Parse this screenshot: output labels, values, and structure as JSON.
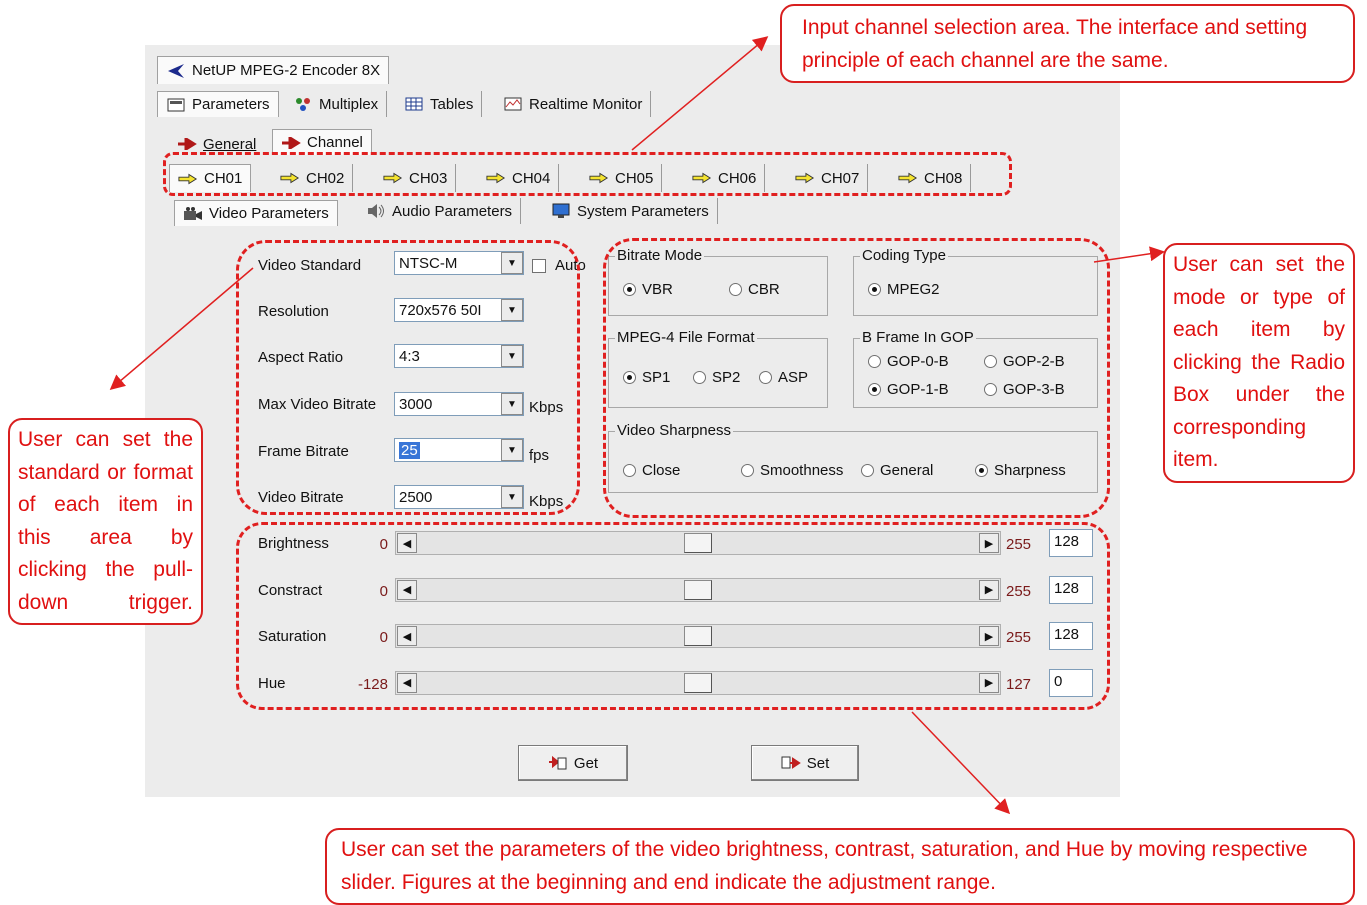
{
  "app": {
    "title": "NetUP MPEG-2 Encoder 8X"
  },
  "main_tabs": [
    {
      "label": "Parameters",
      "icon": "parameters-icon"
    },
    {
      "label": "Multiplex",
      "icon": "multiplex-icon"
    },
    {
      "label": "Tables",
      "icon": "tables-icon"
    },
    {
      "label": "Realtime Monitor",
      "icon": "realtime-monitor-icon"
    }
  ],
  "sub_tabs": [
    {
      "label": "General",
      "icon": "red-arrow-icon"
    },
    {
      "label": "Channel",
      "icon": "red-arrow-icon"
    }
  ],
  "channels": [
    "CH01",
    "CH02",
    "CH03",
    "CH04",
    "CH05",
    "CH06",
    "CH07",
    "CH08"
  ],
  "param_tabs": [
    {
      "label": "Video Parameters",
      "icon": "video-camera-icon"
    },
    {
      "label": "Audio Parameters",
      "icon": "speaker-icon"
    },
    {
      "label": "System Parameters",
      "icon": "monitor-icon"
    }
  ],
  "video": {
    "standard": {
      "label": "Video Standard",
      "value": "NTSC-M",
      "auto_label": "Auto",
      "auto_checked": false
    },
    "resolution": {
      "label": "Resolution",
      "value": "720x576 50I"
    },
    "aspect_ratio": {
      "label": "Aspect Ratio",
      "value": "4:3"
    },
    "max_bitrate": {
      "label": "Max Video Bitrate",
      "value": "3000",
      "unit": "Kbps"
    },
    "frame_bitrate": {
      "label": "Frame Bitrate",
      "value": "25",
      "unit": "fps"
    },
    "video_bitrate": {
      "label": "Video Bitrate",
      "value": "2500",
      "unit": "Kbps"
    }
  },
  "groups": {
    "bitrate_mode": {
      "title": "Bitrate Mode",
      "options": [
        "VBR",
        "CBR"
      ],
      "selected": "VBR"
    },
    "coding_type": {
      "title": "Coding Type",
      "options": [
        "MPEG2"
      ],
      "selected": "MPEG2"
    },
    "mpeg4_format": {
      "title": "MPEG-4 File Format",
      "options": [
        "SP1",
        "SP2",
        "ASP"
      ],
      "selected": "SP1"
    },
    "b_frame": {
      "title": "B Frame In GOP",
      "options": [
        "GOP-0-B",
        "GOP-2-B",
        "GOP-1-B",
        "GOP-3-B"
      ],
      "selected": "GOP-1-B"
    },
    "sharpness": {
      "title": "Video Sharpness",
      "options": [
        "Close",
        "Smoothness",
        "General",
        "Sharpness"
      ],
      "selected": "Sharpness"
    }
  },
  "sliders": [
    {
      "label": "Brightness",
      "min": "0",
      "max": "255",
      "value": "128",
      "position": 0.5
    },
    {
      "label": "Constract",
      "min": "0",
      "max": "255",
      "value": "128",
      "position": 0.5
    },
    {
      "label": "Saturation",
      "min": "0",
      "max": "255",
      "value": "128",
      "position": 0.5
    },
    {
      "label": "Hue",
      "min": "-128",
      "max": "127",
      "value": "0",
      "position": 0.5
    }
  ],
  "buttons": {
    "get": "Get",
    "set": "Set"
  },
  "annotations": {
    "top": "Input channel selection area. The interface and setting principle of each channel are the same.",
    "left": "User can set the standard or format of each item in this area by clicking the pull-down trigger.",
    "right": "User can set the mode or type of each item by clicking the Radio Box under the corresponding item.",
    "bottom": "User can set the parameters of the video brightness, contrast, saturation, and Hue by moving respective slider. Figures at the beginning and end indicate the adjustment range."
  },
  "colors": {
    "annotation": "#e02020",
    "selection": "#3875d7",
    "range_text": "#7a1a1a"
  }
}
